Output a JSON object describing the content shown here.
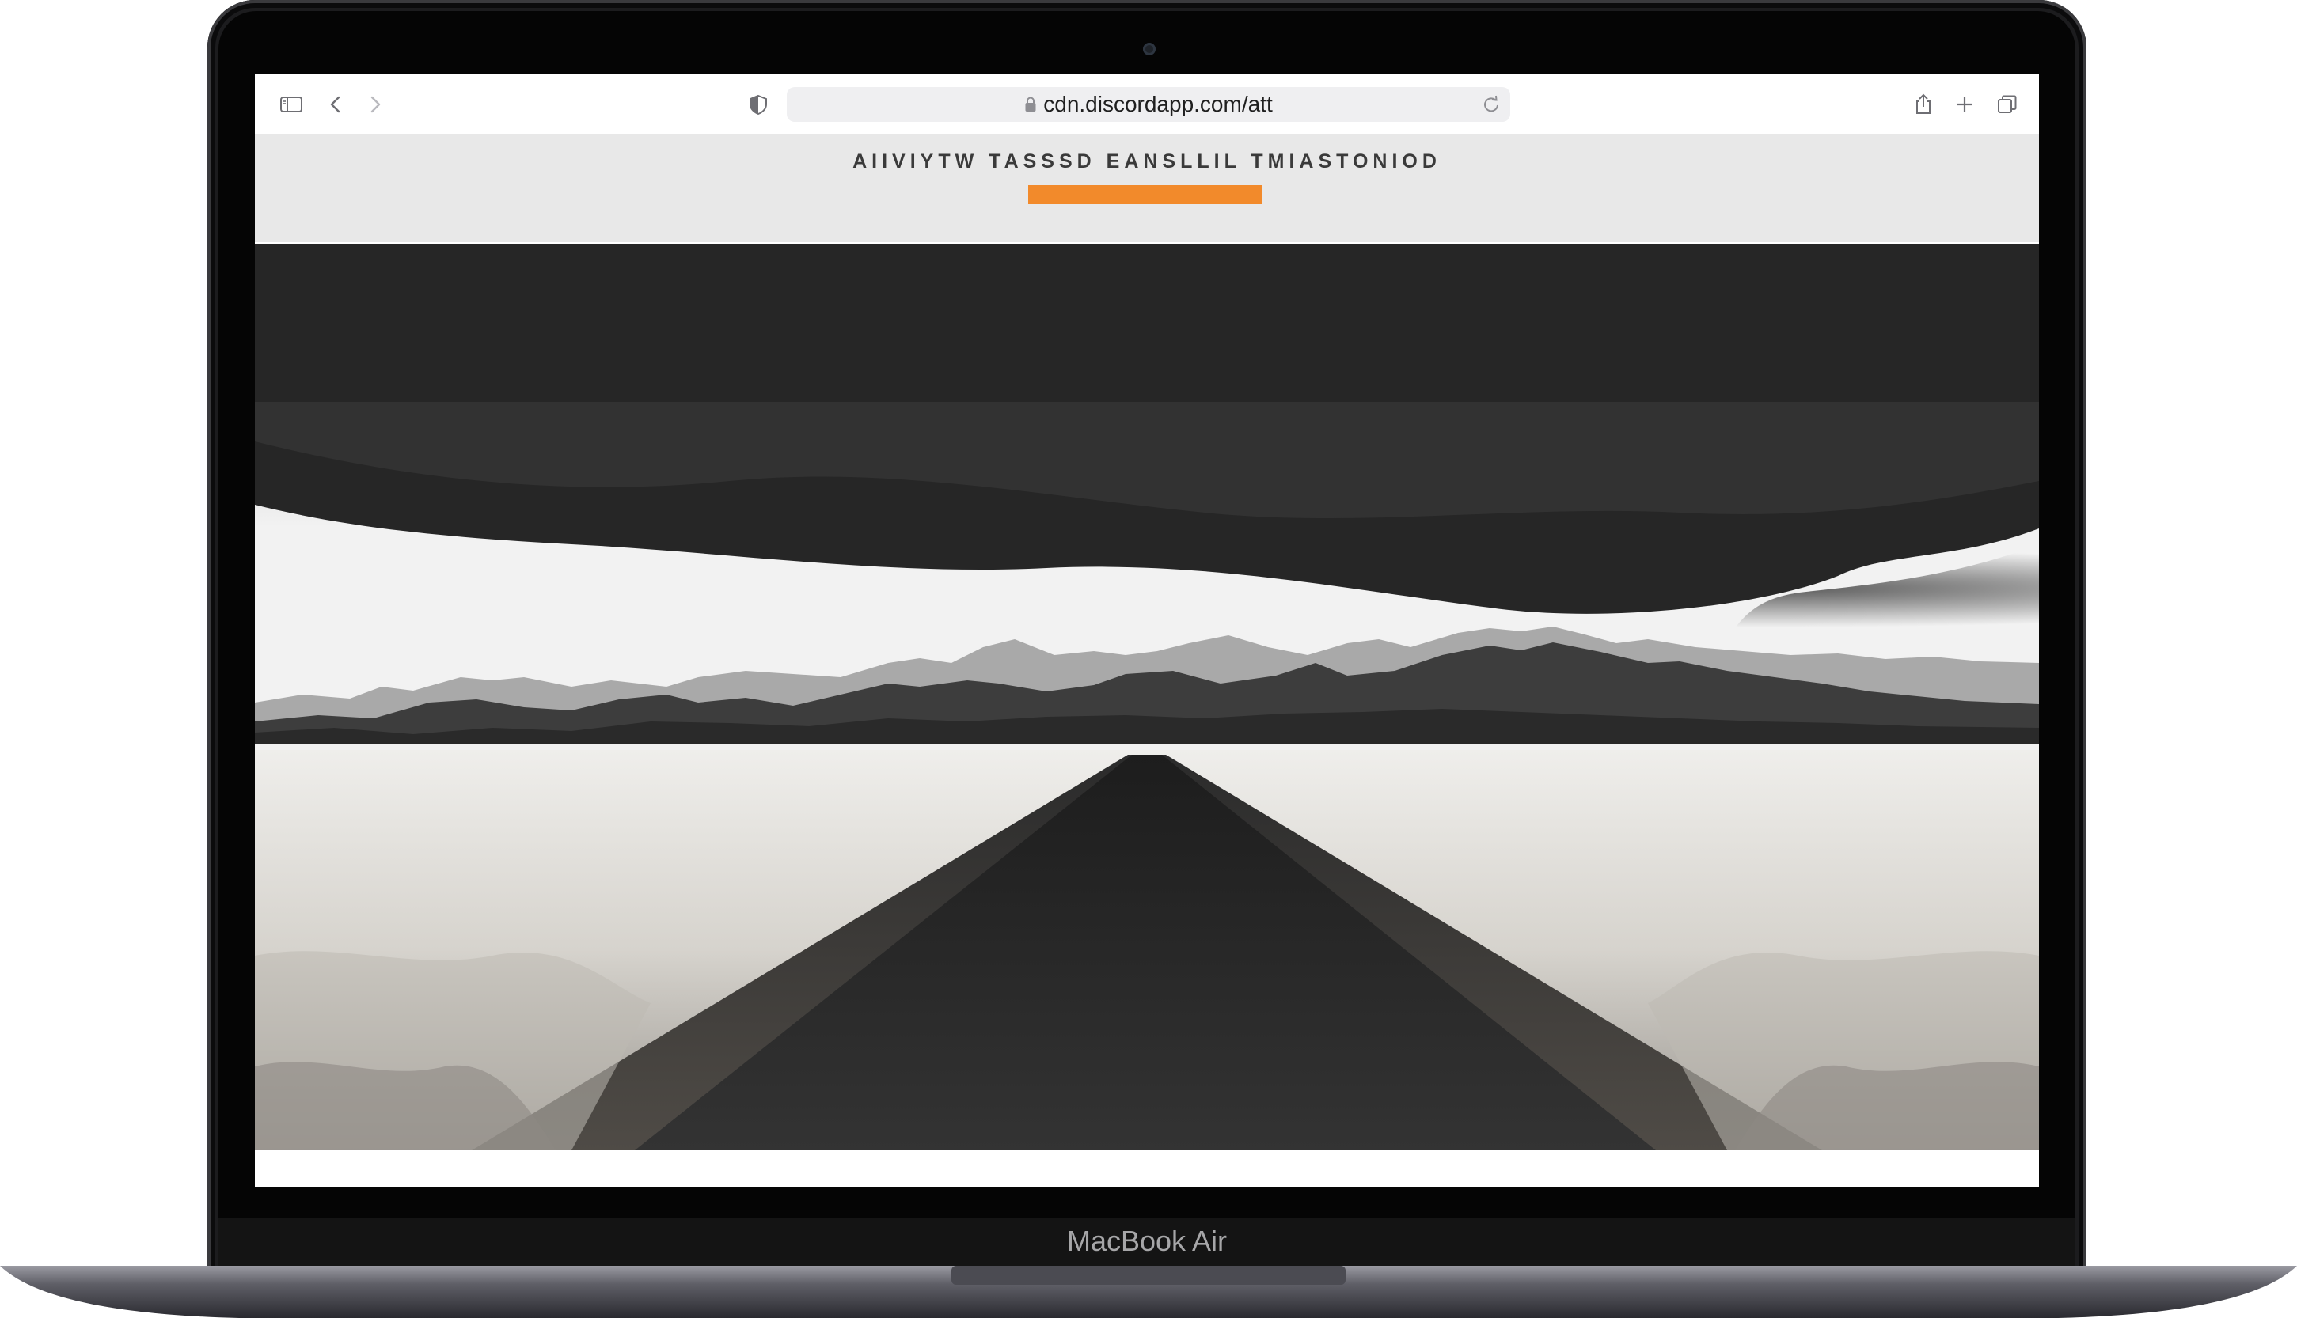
{
  "browser": {
    "url": "cdn.discordapp.com/att",
    "icons": {
      "sidebar": "sidebar-icon",
      "back": "chevron-left-icon",
      "forward": "chevron-right-icon",
      "privacy": "shield-icon",
      "lock": "lock-icon",
      "reload": "reload-icon",
      "share": "share-icon",
      "new_tab": "plus-icon",
      "tabs": "tab-overview-icon"
    }
  },
  "page": {
    "title": "AIIVIYTW TASSSD EANSLLIL TMIASTONIOD",
    "accent_color": "#f28a2b",
    "hero_image": "black-and-white road through grassland toward mountains under storm clouds"
  },
  "device": {
    "model": "MacBook Air"
  }
}
